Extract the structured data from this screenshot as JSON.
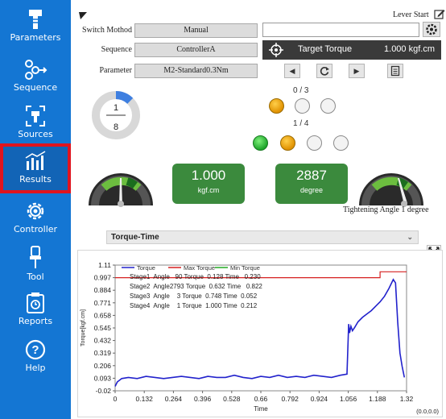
{
  "sidebar": {
    "items": [
      {
        "label": "Parameters",
        "icon": "wrench-icon"
      },
      {
        "label": "Sequence",
        "icon": "sequence-icon"
      },
      {
        "label": "Sources",
        "icon": "sources-icon"
      },
      {
        "label": "Results",
        "icon": "bar-chart-icon",
        "active": true
      },
      {
        "label": "Controller",
        "icon": "gear-icon"
      },
      {
        "label": "Tool",
        "icon": "screwdriver-icon"
      },
      {
        "label": "Reports",
        "icon": "clipboard-icon"
      },
      {
        "label": "Help",
        "icon": "help-icon"
      }
    ]
  },
  "header": {
    "lever_start": "Lever Start"
  },
  "form": {
    "switch_method_label": "Switch Mothod",
    "switch_method_value": "Manual",
    "sequence_label": "Sequence",
    "sequence_value": "ControllerA",
    "parameter_label": "Parameter",
    "parameter_value": "M2-Standard0.3Nm",
    "search_value": ""
  },
  "target": {
    "label": "Target Torque",
    "value": "1.000 kgf.cm"
  },
  "progress": {
    "numerator": "1",
    "denominator": "8",
    "fraction": 0.125
  },
  "stage_counts": {
    "top": "0 / 3",
    "bottom": "1 / 4"
  },
  "readouts": {
    "torque_value": "1.000",
    "torque_unit": "kgf.cm",
    "angle_value": "2887",
    "angle_unit": "degree",
    "tightening_angle": "Tightening Angle 1 degree"
  },
  "chart_title": "Torque-Time",
  "colors": {
    "sidebar": "#1476d3",
    "active_outline": "#e0141e",
    "card_green": "#3b8a3d",
    "torque_line": "#2222cc",
    "max_line": "#d62020",
    "min_line": "#22aa22"
  },
  "chart_data": {
    "type": "line",
    "xlabel": "Time",
    "ylabel": "Torque[kgf.cm]",
    "xlim": [
      0,
      1.32
    ],
    "ylim": [
      -0.02,
      1.11
    ],
    "x_ticks": [
      "0",
      "0.132",
      "0.264",
      "0.396",
      "0.528",
      "0.66",
      "0.792",
      "0.924",
      "1.056",
      "1.188",
      "1.32"
    ],
    "y_ticks": [
      "1.11",
      "0.997",
      "0.884",
      "0.771",
      "0.658",
      "0.545",
      "0.432",
      "0.319",
      "0.206",
      "0.093",
      "-0.02"
    ],
    "corner_label": "(0.0,0.0)",
    "legend": [
      "Torque",
      "Max Torque",
      "Min Torque"
    ],
    "stages": [
      "Stage1  Angle   90 Torque  0.128 Time   0.230",
      "Stage2  Angle2793 Torque  0.632 Time   0.822",
      "Stage3  Angle    3 Torque  0.748 Time  0.052",
      "Stage4  Angle    1 Torque  1.000 Time  0.212"
    ],
    "series": [
      {
        "name": "Torque",
        "x": [
          0,
          0.01,
          0.03,
          0.06,
          0.1,
          0.14,
          0.18,
          0.22,
          0.26,
          0.3,
          0.34,
          0.38,
          0.42,
          0.46,
          0.5,
          0.54,
          0.58,
          0.62,
          0.66,
          0.7,
          0.74,
          0.78,
          0.82,
          0.86,
          0.9,
          0.94,
          0.98,
          1.02,
          1.05,
          1.058,
          1.062,
          1.068,
          1.075,
          1.085,
          1.1,
          1.12,
          1.14,
          1.16,
          1.18,
          1.2,
          1.22,
          1.24,
          1.26,
          1.27,
          1.28,
          1.29,
          1.3,
          1.31
        ],
        "y": [
          0.02,
          0.06,
          0.09,
          0.1,
          0.09,
          0.11,
          0.1,
          0.09,
          0.1,
          0.11,
          0.1,
          0.09,
          0.11,
          0.1,
          0.1,
          0.12,
          0.1,
          0.09,
          0.11,
          0.1,
          0.12,
          0.1,
          0.11,
          0.1,
          0.12,
          0.11,
          0.1,
          0.12,
          0.13,
          0.58,
          0.5,
          0.56,
          0.52,
          0.55,
          0.6,
          0.64,
          0.67,
          0.7,
          0.74,
          0.78,
          0.83,
          0.9,
          0.98,
          0.95,
          0.6,
          0.32,
          0.2,
          0.1
        ]
      },
      {
        "name": "Max Torque",
        "x": [
          0,
          1.2,
          1.2,
          1.32
        ],
        "y": [
          0.997,
          0.997,
          1.05,
          1.05
        ]
      }
    ]
  }
}
